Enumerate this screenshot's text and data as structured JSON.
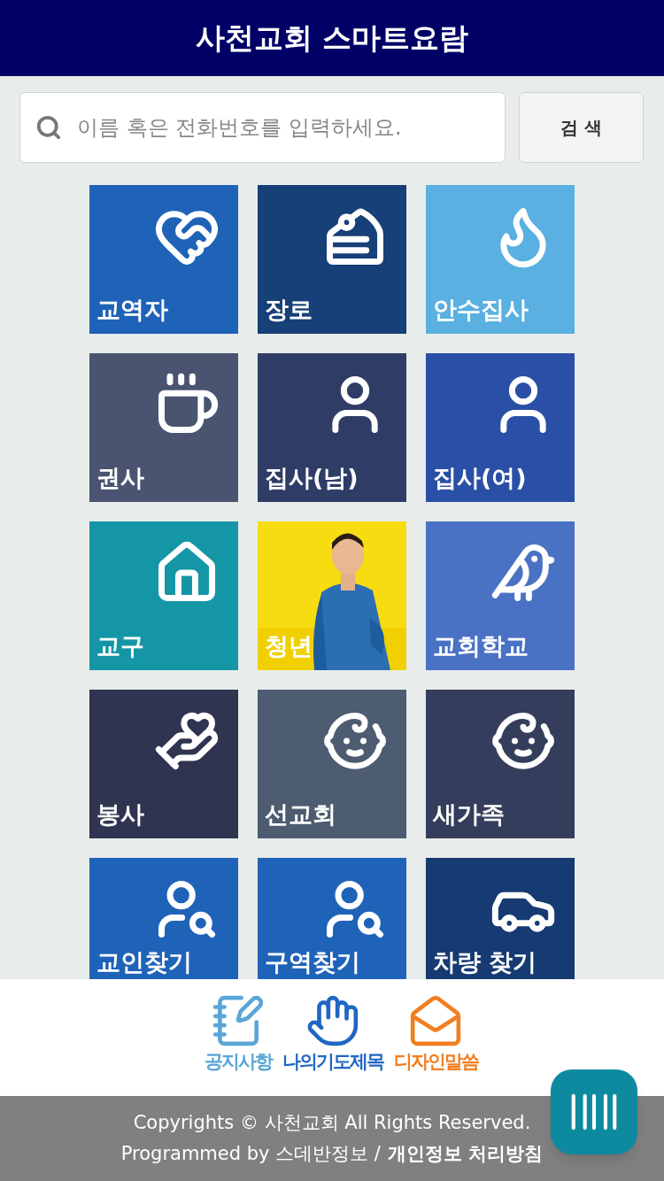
{
  "header": {
    "title": "사천교회 스마트요람"
  },
  "search": {
    "placeholder": "이름 혹은 전화번호를 입력하세요.",
    "button": "검 색"
  },
  "tiles": [
    {
      "label": "교역자",
      "kind": "icon",
      "color": "#1f63b8"
    },
    {
      "label": "장로",
      "kind": "icon",
      "color": "#173f78"
    },
    {
      "label": "안수집사",
      "kind": "icon",
      "color": "#5ab0e0"
    },
    {
      "label": "권사",
      "kind": "icon",
      "color": "#4a5470"
    },
    {
      "label": "집사(남)",
      "kind": "icon",
      "color": "#2f3d66"
    },
    {
      "label": "집사(여)",
      "kind": "icon",
      "color": "#2a4fa6"
    },
    {
      "label": "교구",
      "kind": "icon",
      "color": "#1596a6"
    },
    {
      "label": "청년",
      "kind": "picture",
      "color": "#f7dc12"
    },
    {
      "label": "교회학교",
      "kind": "icon",
      "color": "#4a72c4"
    },
    {
      "label": "봉사",
      "kind": "icon",
      "color": "#2f3450"
    },
    {
      "label": "선교회",
      "kind": "icon",
      "color": "#4d5c70"
    },
    {
      "label": "새가족",
      "kind": "icon",
      "color": "#343e5c"
    },
    {
      "label": "교인찾기",
      "kind": "icon",
      "color": "#1f63b8"
    },
    {
      "label": "구역찾기",
      "kind": "icon",
      "color": "#1f63b8"
    },
    {
      "label": "차량 찾기",
      "kind": "icon",
      "color": "#163a72"
    }
  ],
  "bottom_nav": [
    {
      "label": "공지사항",
      "color": "#5aa6d6"
    },
    {
      "label": "나의기도제목",
      "color": "#2067c4"
    },
    {
      "label": "디자인말씀",
      "color": "#f07f20"
    }
  ],
  "footer": {
    "copyright": "Copyrights © 사천교회 All Rights Reserved.",
    "programmed": "Programmed by 스데반정보 /",
    "privacy_link": "개인정보 처리방침"
  }
}
